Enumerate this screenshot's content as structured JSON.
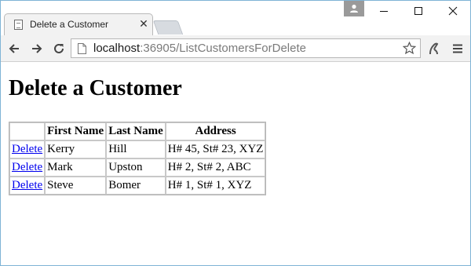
{
  "browser": {
    "tab_title": "Delete a Customer",
    "tab_close": "✕",
    "url_host": "localhost",
    "url_path": ":36905/ListCustomersForDelete"
  },
  "page": {
    "heading": "Delete a Customer",
    "table": {
      "headers": [
        "",
        "First Name",
        "Last Name",
        "Address"
      ],
      "rows": [
        {
          "action": "Delete",
          "first": "Kerry",
          "last": "Hill",
          "address": "H# 45, St# 23, XYZ"
        },
        {
          "action": "Delete",
          "first": "Mark",
          "last": "Upston",
          "address": "H# 2, St# 2, ABC"
        },
        {
          "action": "Delete",
          "first": "Steve",
          "last": "Bomer",
          "address": "H# 1, St# 1, XYZ"
        }
      ]
    }
  },
  "colors": {
    "link": "#0000ee",
    "window_border": "#7fb4d6",
    "toolbar_bg": "#f2f2f2"
  },
  "icons": [
    "page-icon",
    "back-arrow-icon",
    "forward-arrow-icon",
    "reload-icon",
    "star-icon",
    "extension-icon",
    "menu-icon",
    "profile-icon",
    "minimize-icon",
    "maximize-icon",
    "close-icon"
  ]
}
